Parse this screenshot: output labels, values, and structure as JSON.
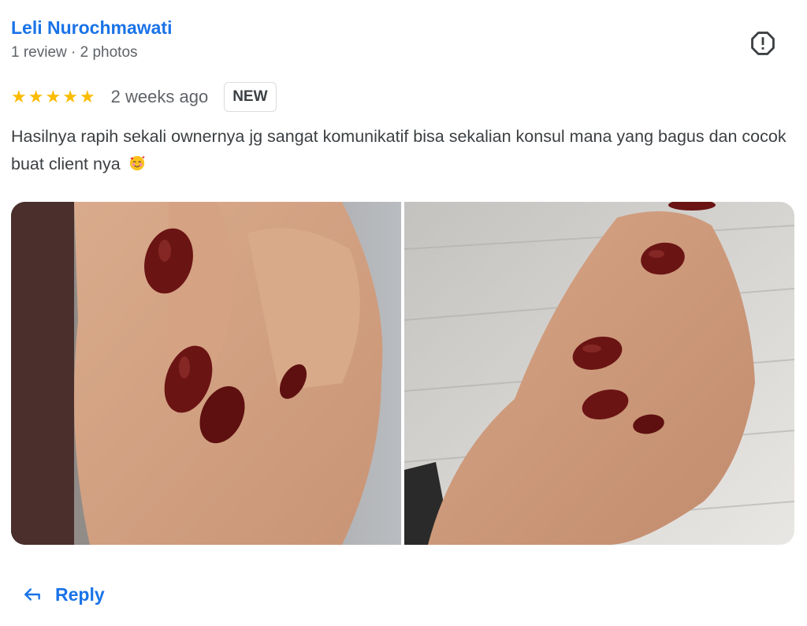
{
  "reviewer": {
    "name": "Leli Nurochmawati",
    "meta": "1 review · 2 photos"
  },
  "rating": {
    "stars": 5,
    "date": "2 weeks ago",
    "badge": "NEW"
  },
  "review": {
    "text": "Hasilnya rapih sekali ownernya jg sangat komunikatif bisa sekalian konsul mana yang bagus dan cocok buat client nya",
    "emoji": "smiling-face-with-hearts"
  },
  "photos": [
    {
      "subject": "hand-with-dark-red-nails"
    },
    {
      "subject": "hand-with-dark-red-nails"
    }
  ],
  "actions": {
    "reply_label": "Reply",
    "report_icon": "report-icon"
  },
  "colors": {
    "link": "#1a73e8",
    "star": "#fbbc04",
    "nail": "#6b1414"
  }
}
